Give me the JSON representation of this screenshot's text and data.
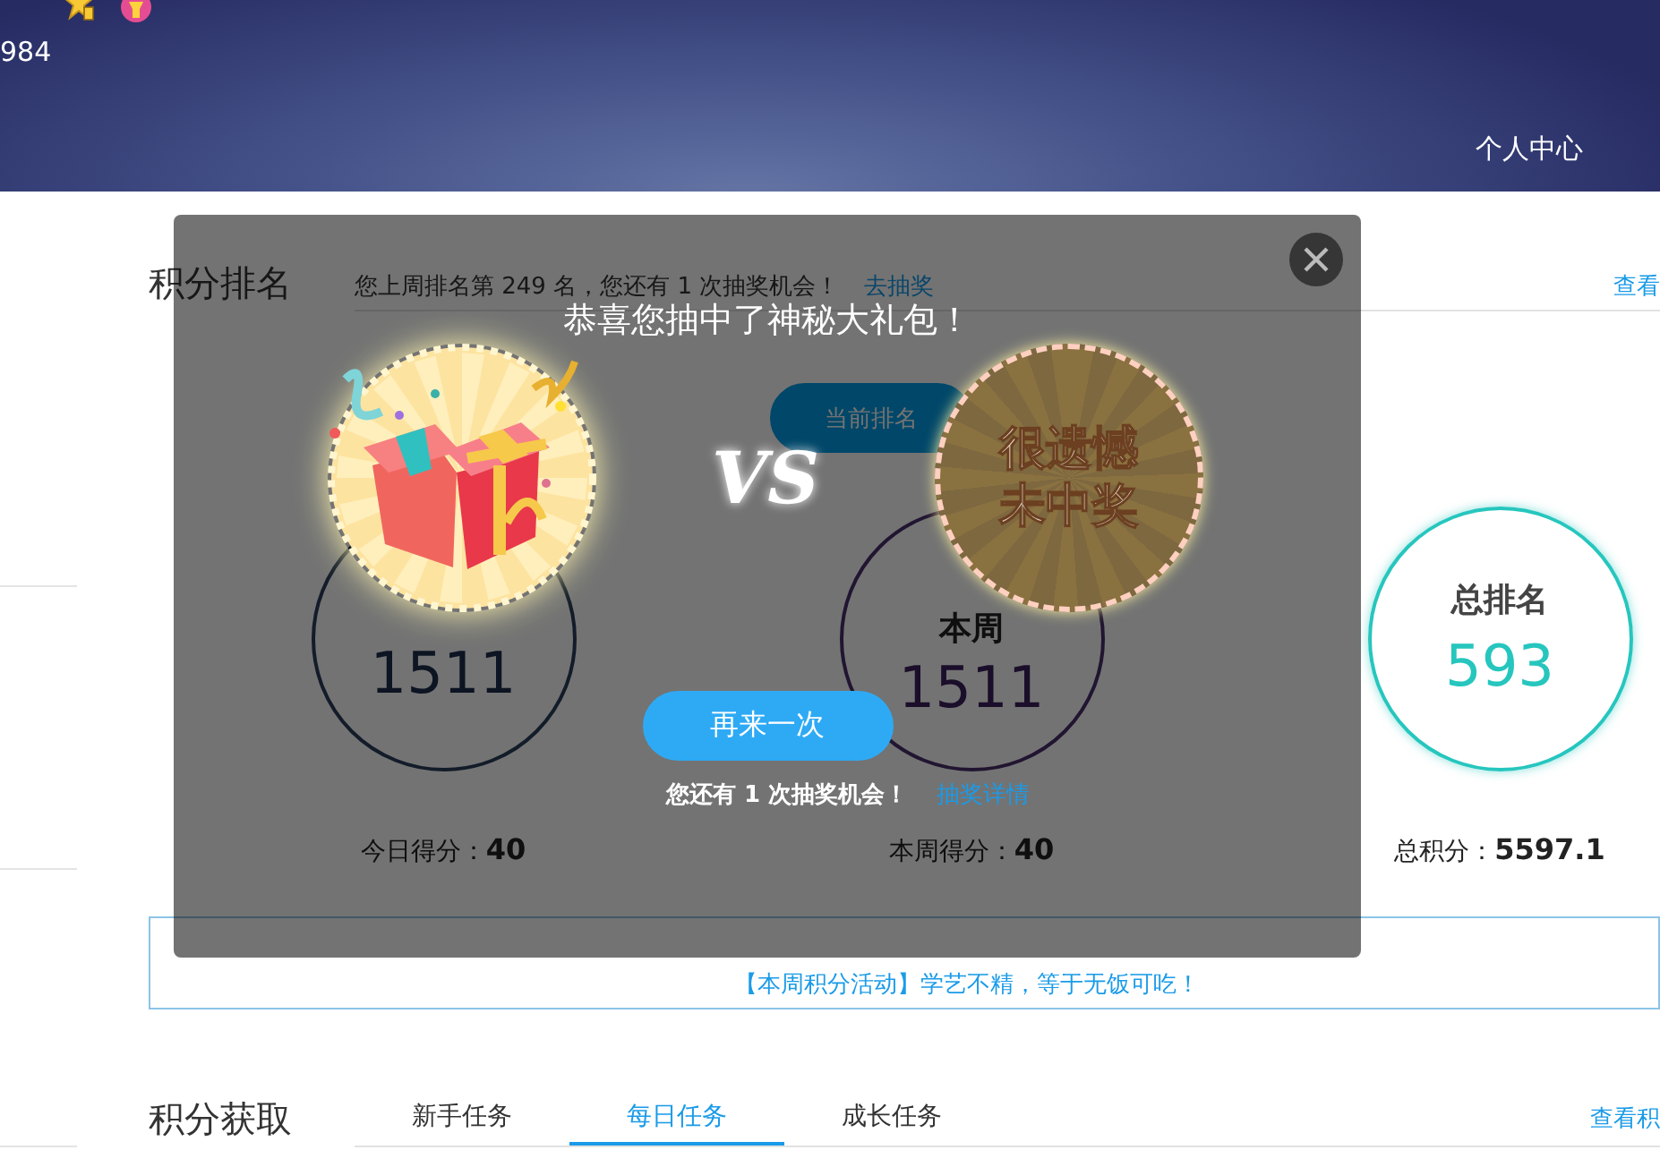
{
  "header": {
    "user_number": "984",
    "menu_link": "个人中心"
  },
  "ranking": {
    "title": "积分排名",
    "notice": "您上周排名第 249 名，您还有 1 次抽奖机会！",
    "notice_link": "去抽奖",
    "more_link": "查看",
    "tabs": [
      {
        "label": "当前排名",
        "selected": true
      }
    ],
    "circles": [
      {
        "value": "1511"
      },
      {
        "label": "本周",
        "value": "1511"
      },
      {
        "label": "总排名",
        "value": "593"
      }
    ],
    "scores": [
      {
        "label": "今日得分：",
        "value": "40"
      },
      {
        "label": "本周得分：",
        "value": "40"
      },
      {
        "label": "总积分：",
        "value": "5597.1"
      }
    ],
    "activity": "【本周积分活动】学艺不精，等于无饭可吃！"
  },
  "tasks": {
    "title": "积分获取",
    "more_link": "查看积",
    "tabs": [
      {
        "label": "新手任务",
        "selected": false
      },
      {
        "label": "每日任务",
        "selected": true
      },
      {
        "label": "成长任务",
        "selected": false
      }
    ]
  },
  "dialog": {
    "title": "恭喜您抽中了神秘大礼包！",
    "versus": "VS",
    "result_lines": [
      "很遗憾",
      "未中奖"
    ],
    "button": "再来一次",
    "chances": "您还有 1 次抽奖机会！",
    "details_link": "抽奖详情"
  }
}
